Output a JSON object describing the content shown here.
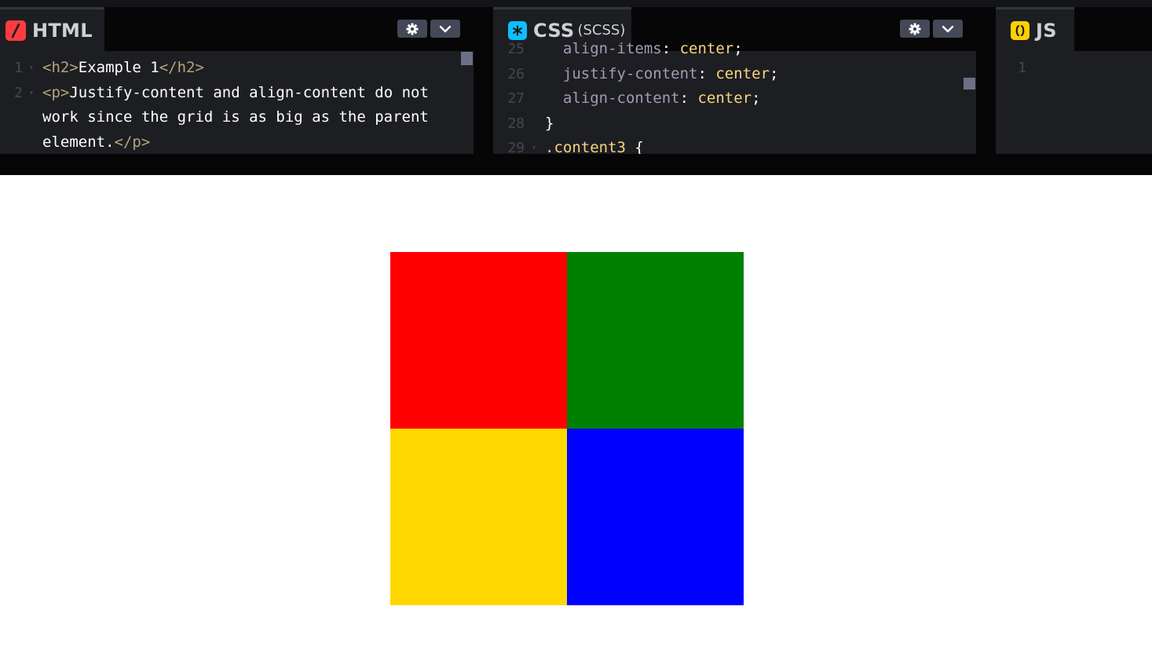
{
  "html_panel": {
    "title": "HTML",
    "icon": "slash-icon",
    "accent": "#ff3c41",
    "lines": [
      {
        "num": "1",
        "parts": [
          [
            "tag",
            "<h2>"
          ],
          [
            "text",
            "Example 1"
          ],
          [
            "tag",
            "</h2>"
          ]
        ]
      },
      {
        "num": "2",
        "parts": [
          [
            "tag",
            "<p>"
          ],
          [
            "text",
            "Justify-content and align-content do not"
          ]
        ]
      },
      {
        "num": "",
        "parts": [
          [
            "text",
            "work since the grid is as big as the parent"
          ]
        ]
      },
      {
        "num": "",
        "parts": [
          [
            "text",
            "element."
          ],
          [
            "tag",
            "</p>"
          ]
        ]
      }
    ]
  },
  "css_panel": {
    "title": "CSS",
    "subtitle": "(SCSS)",
    "icon": "asterisk-icon",
    "accent": "#0ebeff",
    "lines": [
      {
        "num": "25",
        "parts": [
          [
            "prop",
            "  align-items"
          ],
          [
            "text",
            ": "
          ],
          [
            "val",
            "center"
          ],
          [
            "text",
            ";"
          ]
        ]
      },
      {
        "num": "26",
        "parts": [
          [
            "prop",
            "  justify-content"
          ],
          [
            "text",
            ": "
          ],
          [
            "val",
            "center"
          ],
          [
            "text",
            ";"
          ]
        ]
      },
      {
        "num": "27",
        "parts": [
          [
            "prop",
            "  align-content"
          ],
          [
            "text",
            ": "
          ],
          [
            "val",
            "center"
          ],
          [
            "text",
            ";"
          ]
        ]
      },
      {
        "num": "28",
        "parts": [
          [
            "text",
            "}"
          ]
        ]
      },
      {
        "num": "29",
        "parts": [
          [
            "sel",
            ".content3"
          ],
          [
            "text",
            " {"
          ]
        ]
      }
    ]
  },
  "js_panel": {
    "title": "JS",
    "icon": "braces-icon",
    "accent": "#fcd000",
    "lines": [
      {
        "num": "1",
        "parts": []
      }
    ]
  },
  "preview": {
    "cells": [
      {
        "name": "red-cell",
        "color": "#ff0000"
      },
      {
        "name": "green-cell",
        "color": "#008000"
      },
      {
        "name": "yellow-cell",
        "color": "#ffd700"
      },
      {
        "name": "blue-cell",
        "color": "#0000ff"
      }
    ]
  }
}
